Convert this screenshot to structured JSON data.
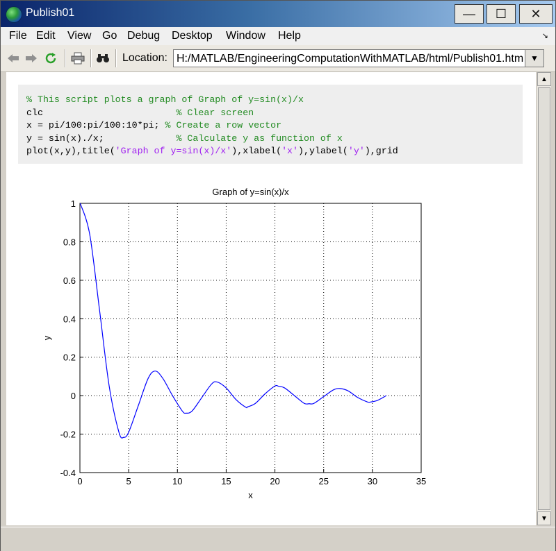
{
  "window": {
    "title": "Publish01",
    "controls": {
      "minimize": "—",
      "maximize": "☐",
      "close": "✕"
    }
  },
  "menu": [
    "File",
    "Edit",
    "View",
    "Go",
    "Debug",
    "Desktop",
    "Window",
    "Help"
  ],
  "toolbar": {
    "icons": [
      "back-arrow-icon",
      "forward-arrow-icon",
      "refresh-icon",
      "print-icon",
      "find-binoculars-icon"
    ],
    "location_label": "Location:",
    "location_value": "H:/MATLAB/EngineeringComputationWithMATLAB/html/Publish01.html"
  },
  "code": {
    "lines": [
      [
        {
          "t": "% This script plots a graph of Graph of y=sin(x)/x",
          "k": "comment"
        }
      ],
      [
        {
          "t": "clc                        ",
          "k": "code"
        },
        {
          "t": "% Clear screen",
          "k": "comment"
        }
      ],
      [
        {
          "t": "x = pi/100:pi/100:10*pi; ",
          "k": "code"
        },
        {
          "t": "% Create a row vector",
          "k": "comment"
        }
      ],
      [
        {
          "t": "y = sin(x)./x;             ",
          "k": "code"
        },
        {
          "t": "% Calculate y as function of x",
          "k": "comment"
        }
      ],
      [
        {
          "t": "plot(x,y),title(",
          "k": "code"
        },
        {
          "t": "'Graph of y=sin(x)/x'",
          "k": "string"
        },
        {
          "t": "),xlabel(",
          "k": "code"
        },
        {
          "t": "'x'",
          "k": "string"
        },
        {
          "t": "),ylabel(",
          "k": "code"
        },
        {
          "t": "'y'",
          "k": "string"
        },
        {
          "t": "),grid",
          "k": "code"
        }
      ]
    ]
  },
  "chart_data": {
    "type": "line",
    "title": "Graph of y=sin(x)/x",
    "xlabel": "x",
    "ylabel": "y",
    "xlim": [
      0,
      35
    ],
    "ylim": [
      -0.4,
      1
    ],
    "xticks": [
      0,
      5,
      10,
      15,
      20,
      25,
      30,
      35
    ],
    "yticks": [
      -0.4,
      -0.2,
      0,
      0.2,
      0.4,
      0.6,
      0.8,
      1
    ],
    "grid": true,
    "series": [
      {
        "color": "#0000ff",
        "x": [
          0.03,
          1,
          2,
          3,
          4,
          4.49,
          5,
          6,
          7,
          7.73,
          8.5,
          9.5,
          10.5,
          10.9,
          11.5,
          12.5,
          13.5,
          14.07,
          15,
          16,
          17,
          17.22,
          18,
          19,
          20,
          20.37,
          21,
          22,
          23,
          23.52,
          24,
          25,
          26,
          26.67,
          27.5,
          28.5,
          29.5,
          29.81,
          30.5,
          31.42
        ],
        "y": [
          1.0,
          0.84,
          0.45,
          0.05,
          -0.19,
          -0.217,
          -0.19,
          -0.05,
          0.09,
          0.128,
          0.09,
          0.0,
          -0.08,
          -0.091,
          -0.08,
          -0.01,
          0.06,
          0.071,
          0.04,
          -0.02,
          -0.06,
          -0.058,
          -0.04,
          0.01,
          0.05,
          0.049,
          0.04,
          0.0,
          -0.04,
          -0.042,
          -0.04,
          -0.005,
          0.03,
          0.037,
          0.025,
          -0.01,
          -0.033,
          -0.033,
          -0.025,
          0.0
        ]
      }
    ]
  }
}
